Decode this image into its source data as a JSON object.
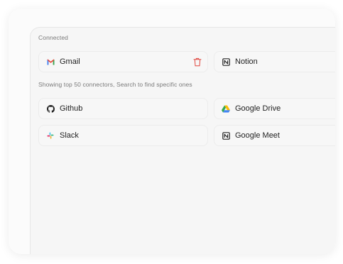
{
  "connected": {
    "label": "Connected",
    "items": [
      {
        "name": "Gmail",
        "icon": "gmail-icon",
        "removable": true
      },
      {
        "name": "Notion",
        "icon": "notion-icon"
      }
    ]
  },
  "available": {
    "hint": "Showing top 50 connectors, Search to find specific ones",
    "items": [
      {
        "name": "Github",
        "icon": "github-icon"
      },
      {
        "name": "Google Drive",
        "icon": "google-drive-icon"
      },
      {
        "name": "Slack",
        "icon": "slack-icon"
      },
      {
        "name": "Google Meet",
        "icon": "google-meet-icon"
      }
    ]
  },
  "colors": {
    "delete": "#e0473f",
    "gmail_red": "#ea4335",
    "drive_green": "#34a853",
    "drive_yellow": "#fbbc04",
    "drive_blue": "#4285f4"
  }
}
